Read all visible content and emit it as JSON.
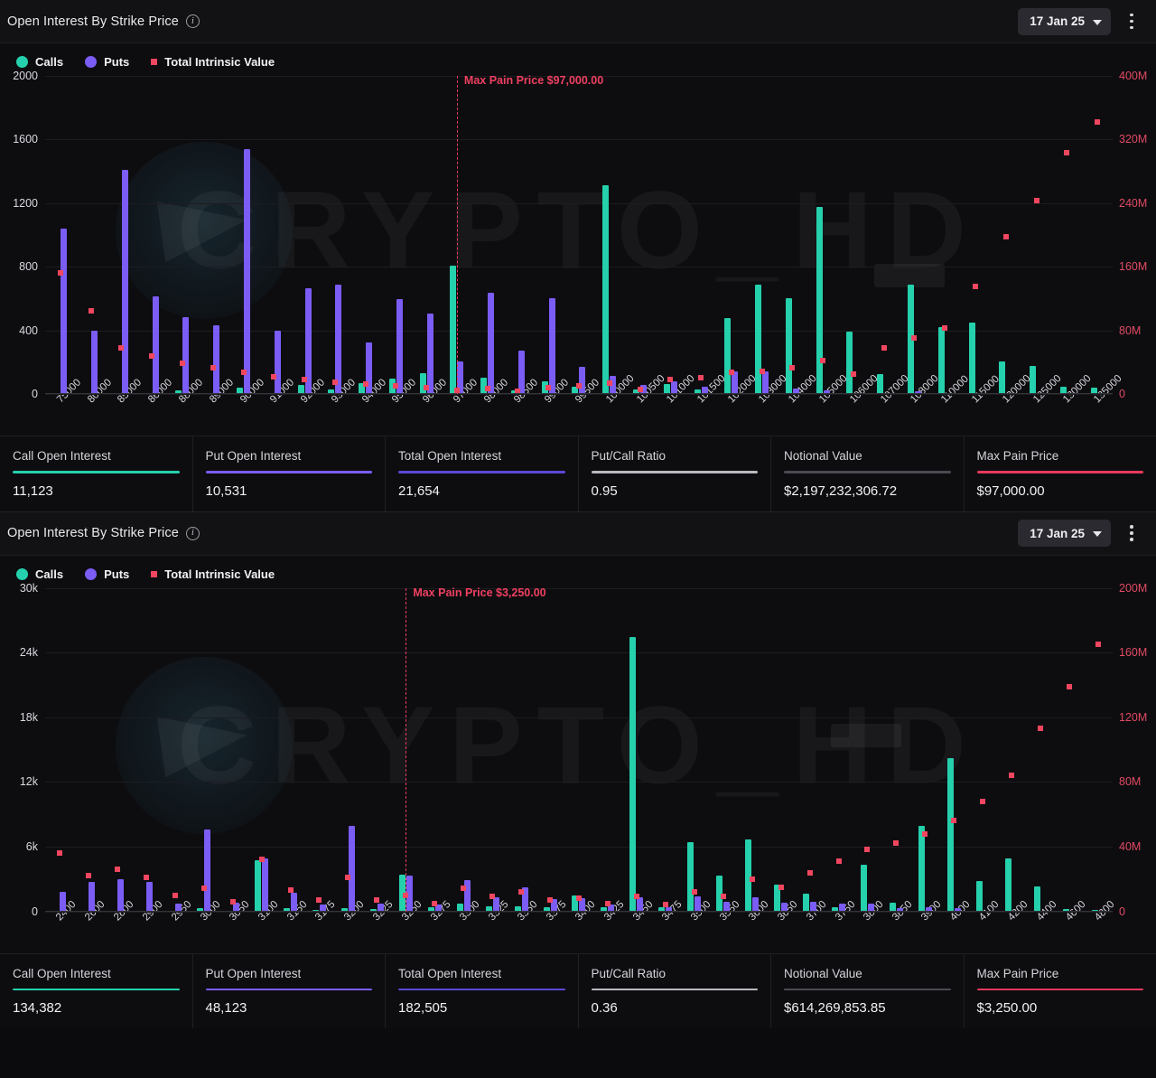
{
  "theme": {
    "bg": "#0d0d10",
    "call_color": "#25d0ac",
    "put_color": "#7b5cf5",
    "tiv_color": "#f0465f",
    "maxpain_color": "#ef4060",
    "total_oi_color": "#5b48d6",
    "ratio_color": "#b9b9c0",
    "notional_color": "#4a4a52"
  },
  "watermark": {
    "text": "CRYPTO_HD"
  },
  "panels": [
    {
      "header": {
        "title": "Open Interest By Strike Price",
        "info_icon": "info-icon",
        "date": "17 Jan 25",
        "menu_icon": "kebab-menu-icon"
      },
      "legend": [
        {
          "label": "Calls",
          "color": "#25d0ac",
          "shape": "circle"
        },
        {
          "label": "Puts",
          "color": "#7b5cf5",
          "shape": "circle"
        },
        {
          "label": "Total Intrinsic Value",
          "color": "#f0465f",
          "shape": "square"
        }
      ],
      "chart_data": {
        "type": "bar",
        "title": "Open Interest By Strike Price",
        "xlabel": "",
        "ylabel": "Open Interest",
        "y2label": "Total Intrinsic Value",
        "grid": true,
        "legend_position": "top-left",
        "ylim": [
          0,
          2000
        ],
        "yticks": [
          "0",
          "400",
          "800",
          "1200",
          "1600",
          "2000"
        ],
        "y2lim": [
          0,
          400000000
        ],
        "y2ticks": [
          "0",
          "80M",
          "160M",
          "240M",
          "320M",
          "400M"
        ],
        "categories": [
          "75000",
          "80000",
          "85000",
          "86000",
          "88000",
          "89000",
          "90000",
          "91000",
          "92000",
          "93000",
          "94000",
          "95000",
          "96000",
          "97000",
          "98000",
          "98500",
          "99000",
          "99500",
          "100000",
          "100500",
          "101000",
          "101500",
          "102000",
          "103000",
          "104000",
          "105000",
          "106000",
          "107000",
          "108000",
          "110000",
          "115000",
          "120000",
          "125000",
          "130000",
          "135000"
        ],
        "series": [
          {
            "name": "Calls",
            "color": "#25d0ac",
            "values": [
              0,
              0,
              0,
              0,
              20,
              0,
              40,
              0,
              55,
              30,
              70,
              95,
              130,
              805,
              100,
              25,
              80,
              45,
              1310,
              30,
              65,
              30,
              480,
              690,
              600,
              1175,
              390,
              125,
              685,
              420,
              450,
              205,
              175,
              45,
              40
            ]
          },
          {
            "name": "Puts",
            "color": "#7b5cf5",
            "values": [
              1040,
              395,
              1410,
              615,
              485,
              430,
              1540,
              400,
              665,
              690,
              325,
              595,
              505,
              205,
              635,
              270,
              600,
              170,
              115,
              55,
              80,
              45,
              140,
              140,
              35,
              20,
              0,
              0,
              15,
              0,
              0,
              0,
              0,
              0,
              0
            ]
          }
        ],
        "overlay": {
          "name": "Total Intrinsic Value",
          "color": "#f0465f",
          "axis": "right",
          "values": [
            152000000,
            104000000,
            58000000,
            48000000,
            39000000,
            33000000,
            27000000,
            22000000,
            18000000,
            15000000,
            13000000,
            10000000,
            8000000,
            5000000,
            6500000,
            3500000,
            8000000,
            10000000,
            14000000,
            6000000,
            18000000,
            21000000,
            27000000,
            28000000,
            33000000,
            42000000,
            25000000,
            58000000,
            70000000,
            83000000,
            135000000,
            198000000,
            243000000,
            303000000,
            342000000
          ]
        },
        "max_pain": {
          "label": "Max Pain Price $97,000.00",
          "value": 97000,
          "category": "97000"
        }
      },
      "stats": [
        {
          "label": "Call Open Interest",
          "value": "11,123",
          "rule_color": "#25d0ac"
        },
        {
          "label": "Put Open Interest",
          "value": "10,531",
          "rule_color": "#7b5cf5"
        },
        {
          "label": "Total Open Interest",
          "value": "21,654",
          "rule_color": "#5b48d6"
        },
        {
          "label": "Put/Call Ratio",
          "value": "0.95",
          "rule_color": "#b9b9c0"
        },
        {
          "label": "Notional Value",
          "value": "$2,197,232,306.72",
          "rule_color": "#4a4a52"
        },
        {
          "label": "Max Pain Price",
          "value": "$97,000.00",
          "rule_color": "#e8395b"
        }
      ]
    },
    {
      "header": {
        "title": "Open Interest By Strike Price",
        "info_icon": "info-icon",
        "date": "17 Jan 25",
        "menu_icon": "kebab-menu-icon"
      },
      "legend": [
        {
          "label": "Calls",
          "color": "#25d0ac",
          "shape": "circle"
        },
        {
          "label": "Puts",
          "color": "#7b5cf5",
          "shape": "circle"
        },
        {
          "label": "Total Intrinsic Value",
          "color": "#f0465f",
          "shape": "square"
        }
      ],
      "chart_data": {
        "type": "bar",
        "title": "Open Interest By Strike Price",
        "xlabel": "",
        "ylabel": "Open Interest",
        "y2label": "Total Intrinsic Value",
        "grid": true,
        "legend_position": "top-left",
        "ylim": [
          0,
          30000
        ],
        "yticks": [
          "0",
          "6k",
          "12k",
          "18k",
          "24k",
          "30k"
        ],
        "y2lim": [
          0,
          200000000
        ],
        "y2ticks": [
          "0",
          "40M",
          "80M",
          "120M",
          "160M",
          "200M"
        ],
        "categories": [
          "2400",
          "2600",
          "2800",
          "2900",
          "2950",
          "3000",
          "3050",
          "3100",
          "3150",
          "3175",
          "3200",
          "3225",
          "3250",
          "3275",
          "3300",
          "3325",
          "3350",
          "3375",
          "3400",
          "3425",
          "3450",
          "3475",
          "3500",
          "3550",
          "3600",
          "3650",
          "3700",
          "3750",
          "3800",
          "3850",
          "3900",
          "4000",
          "4100",
          "4200",
          "4400",
          "4600",
          "4800"
        ],
        "series": [
          {
            "name": "Calls",
            "color": "#25d0ac",
            "values": [
              0,
              0,
              0,
              0,
              0,
              300,
              0,
              4700,
              300,
              100,
              300,
              200,
              3400,
              400,
              700,
              500,
              500,
              400,
              1500,
              400,
              25400,
              400,
              6400,
              3300,
              6700,
              2500,
              1600,
              400,
              4300,
              800,
              7900,
              14200,
              2800,
              4900,
              2300,
              200,
              100
            ]
          },
          {
            "name": "Puts",
            "color": "#7b5cf5",
            "values": [
              1800,
              2700,
              3000,
              2700,
              700,
              7600,
              800,
              4900,
              1700,
              600,
              7900,
              700,
              3300,
              600,
              2900,
              1300,
              2200,
              1100,
              1200,
              600,
              1300,
              400,
              1400,
              900,
              1300,
              800,
              900,
              700,
              700,
              300,
              400,
              300,
              0,
              0,
              0,
              0,
              0
            ]
          }
        ],
        "overlay": {
          "name": "Total Intrinsic Value",
          "color": "#f0465f",
          "axis": "right",
          "values": [
            36000000,
            22000000,
            26000000,
            21000000,
            10000000,
            14000000,
            6000000,
            32000000,
            13000000,
            7000000,
            21000000,
            7000000,
            10000000,
            5000000,
            14000000,
            9000000,
            12000000,
            7000000,
            8000000,
            5000000,
            9000000,
            4000000,
            12000000,
            9000000,
            20000000,
            15000000,
            24000000,
            31000000,
            38000000,
            42000000,
            48000000,
            56000000,
            68000000,
            84000000,
            113000000,
            139000000,
            165000000
          ]
        },
        "max_pain": {
          "label": "Max Pain Price $3,250.00",
          "value": 3250,
          "category": "3250"
        }
      },
      "stats": [
        {
          "label": "Call Open Interest",
          "value": "134,382",
          "rule_color": "#25d0ac"
        },
        {
          "label": "Put Open Interest",
          "value": "48,123",
          "rule_color": "#7b5cf5"
        },
        {
          "label": "Total Open Interest",
          "value": "182,505",
          "rule_color": "#5b48d6"
        },
        {
          "label": "Put/Call Ratio",
          "value": "0.36",
          "rule_color": "#b9b9c0"
        },
        {
          "label": "Notional Value",
          "value": "$614,269,853.85",
          "rule_color": "#4a4a52"
        },
        {
          "label": "Max Pain Price",
          "value": "$3,250.00",
          "rule_color": "#e8395b"
        }
      ]
    }
  ]
}
